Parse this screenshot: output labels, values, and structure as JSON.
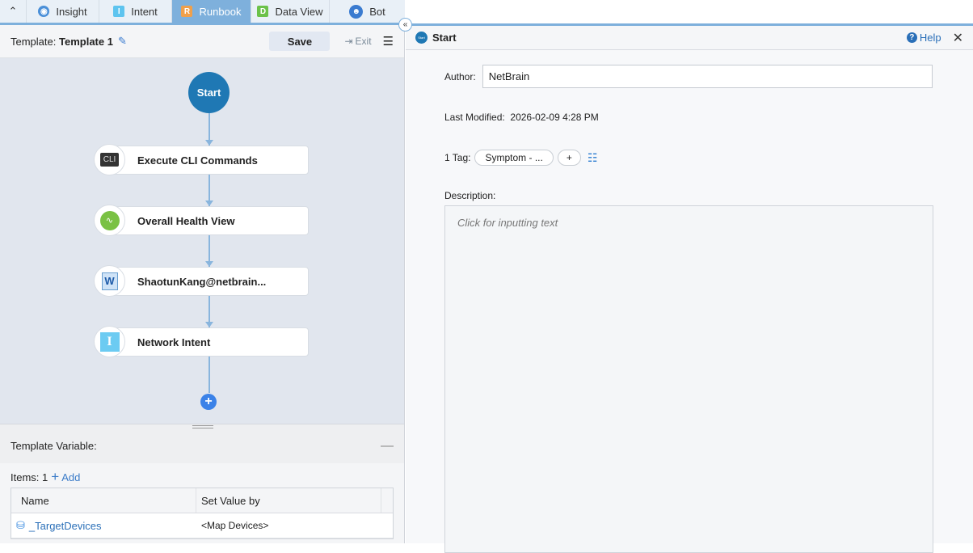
{
  "tabs": [
    {
      "label": "Insight",
      "icon": "insight-ai-icon"
    },
    {
      "label": "Intent",
      "icon": "I"
    },
    {
      "label": "Runbook",
      "icon": "R",
      "active": true
    },
    {
      "label": "Data View",
      "icon": "D"
    },
    {
      "label": "Bot",
      "icon": "bot-icon"
    }
  ],
  "header": {
    "template_label": "Template:",
    "template_name": "Template 1",
    "save": "Save",
    "exit": "Exit"
  },
  "flow": {
    "start": "Start",
    "nodes": [
      {
        "label": "Execute CLI Commands",
        "icon_text": "CLI"
      },
      {
        "label": "Overall Health View"
      },
      {
        "label": "ShaotunKang@netbrain..."
      },
      {
        "label": "Network Intent",
        "icon_text": "I"
      }
    ]
  },
  "variables": {
    "title": "Template Variable:",
    "items_label": "Items: 1",
    "add": "Add",
    "columns": [
      "Name",
      "Set Value by"
    ],
    "rows": [
      {
        "name": "_TargetDevices",
        "value": "<Map Devices>"
      }
    ]
  },
  "detail": {
    "title": "Start",
    "icon_text": "Start",
    "help": "Help",
    "author_label": "Author:",
    "author": "NetBrain",
    "modified_label": "Last Modified:",
    "modified": "2026-02-09 4:28 PM",
    "tag_label": "1 Tag:",
    "tag": "Symptom - ...",
    "tag_add": "+",
    "desc_label": "Description:",
    "desc_placeholder": "Click for inputting text"
  },
  "colors": {
    "accent": "#1f78b4",
    "tab_active": "#7eb0dc"
  }
}
